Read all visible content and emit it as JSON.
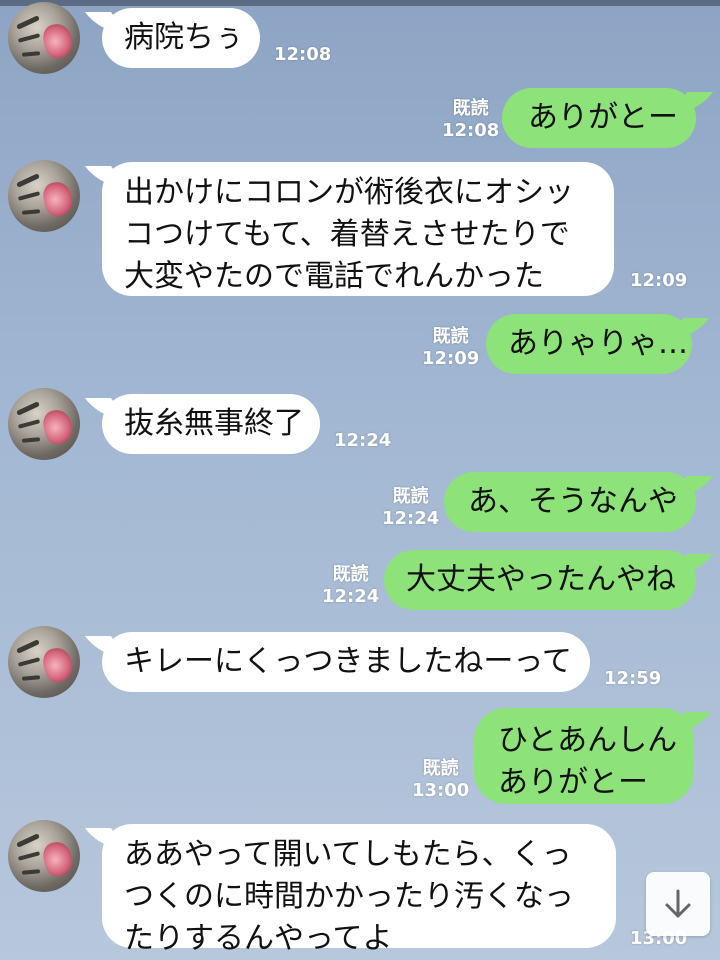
{
  "messages": [
    {
      "side": "in",
      "text": "病院ちぅ",
      "time": "12:08"
    },
    {
      "side": "out",
      "text": "ありがとー",
      "read": "既読",
      "time": "12:08"
    },
    {
      "side": "in",
      "text": "出かけにコロンが術後衣にオシッ\nコつけてもて、着替えさせたりで\n大変やたので電話でれんかった",
      "time": "12:09"
    },
    {
      "side": "out",
      "text": "ありゃりゃ…",
      "read": "既読",
      "time": "12:09"
    },
    {
      "side": "in",
      "text": "抜糸無事終了",
      "time": "12:24"
    },
    {
      "side": "out",
      "text": "あ、そうなんや",
      "read": "既読",
      "time": "12:24"
    },
    {
      "side": "out",
      "text": "大丈夫やったんやね",
      "read": "既読",
      "time": "12:24"
    },
    {
      "side": "in",
      "text": "キレーにくっつきましたねーって",
      "time": "12:59"
    },
    {
      "side": "out",
      "text": "ひとあんしん\nありがとー",
      "read": "既読",
      "time": "13:00"
    },
    {
      "side": "in",
      "text": "ああやって開いてしもたら、くっ\nつくのに時間かかったり汚くなっ\nたりするんやってよ",
      "time": "13:00"
    }
  ],
  "scroll_button": {
    "icon": "arrow-down-icon"
  },
  "colors": {
    "incoming_bubble": "#ffffff",
    "outgoing_bubble": "#8ee27a",
    "background": "#a3b8d3",
    "timestamp": "#ffffff"
  }
}
